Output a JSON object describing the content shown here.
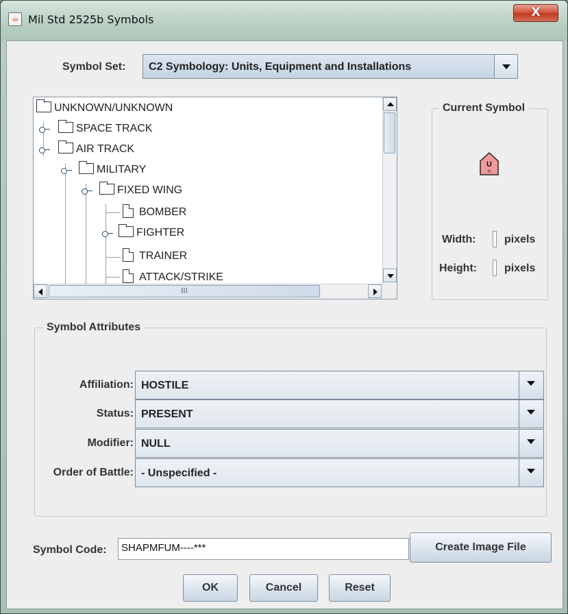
{
  "window": {
    "title": "Mil Std 2525b Symbols",
    "close_glyph": "X"
  },
  "symbol_set": {
    "label": "Symbol Set:",
    "value": "C2 Symbology: Units, Equipment and Installations"
  },
  "tree": {
    "nodes": [
      {
        "label": "UNKNOWN/UNKNOWN",
        "type": "folder"
      },
      {
        "label": "SPACE TRACK",
        "type": "folder"
      },
      {
        "label": "AIR TRACK",
        "type": "folder"
      },
      {
        "label": "MILITARY",
        "type": "folder"
      },
      {
        "label": "FIXED WING",
        "type": "folder"
      },
      {
        "label": "BOMBER",
        "type": "leaf"
      },
      {
        "label": "FIGHTER",
        "type": "folder"
      },
      {
        "label": "TRAINER",
        "type": "leaf"
      },
      {
        "label": "ATTACK/STRIKE",
        "type": "leaf"
      }
    ],
    "hscroll_grip": "III"
  },
  "current_symbol": {
    "title": "Current Symbol",
    "glyph_top": "U",
    "glyph_bottom": "H",
    "width_label": "Width:",
    "height_label": "Height:",
    "units": "pixels",
    "colors": {
      "fill": "#f19a9a",
      "stroke": "#222222"
    }
  },
  "attributes": {
    "title": "Symbol Attributes",
    "affiliation": {
      "label": "Affiliation:",
      "value": "HOSTILE"
    },
    "status": {
      "label": "Status:",
      "value": "PRESENT"
    },
    "modifier": {
      "label": "Modifier:",
      "value": "NULL"
    },
    "order_of_battle": {
      "label": "Order of Battle:",
      "value": "- Unspecified -"
    }
  },
  "symbol_code": {
    "label": "Symbol Code:",
    "value": "SHAPMFUM----***"
  },
  "buttons": {
    "create_image": "Create Image File",
    "ok": "OK",
    "cancel": "Cancel",
    "reset": "Reset"
  }
}
